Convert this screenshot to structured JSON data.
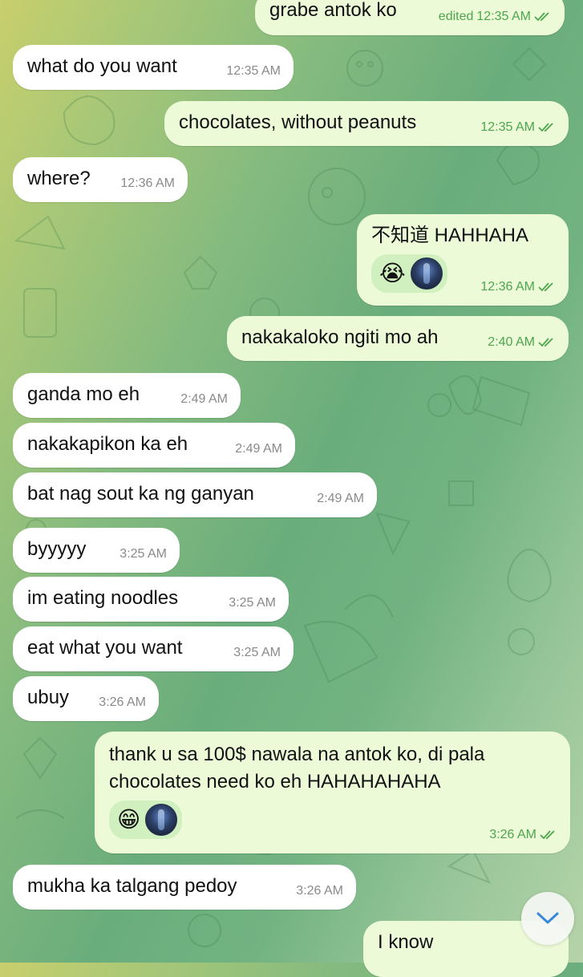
{
  "chat": {
    "messages": [
      {
        "id": "m1",
        "side": "out",
        "text": "grabe antok ko",
        "edited_label": "edited",
        "time": "12:35 AM",
        "read": true
      },
      {
        "id": "m2",
        "side": "in",
        "text": "what do you want",
        "time": "12:35 AM"
      },
      {
        "id": "m3",
        "side": "out",
        "text": "chocolates, without peanuts",
        "time": "12:35 AM",
        "read": true
      },
      {
        "id": "m4",
        "side": "in",
        "text": "where?",
        "time": "12:36 AM"
      },
      {
        "id": "m5",
        "side": "out",
        "text": "不知道 HAHHAHA",
        "reaction_emoji": "😭",
        "reaction_avatar": "avatar",
        "time": "12:36 AM",
        "read": true
      },
      {
        "id": "m6",
        "side": "out",
        "text": "nakakaloko ngiti mo ah",
        "time": "2:40 AM",
        "read": true
      },
      {
        "id": "m7",
        "side": "in",
        "text": "ganda mo eh",
        "time": "2:49 AM"
      },
      {
        "id": "m8",
        "side": "in",
        "text": "nakakapikon ka eh",
        "time": "2:49 AM"
      },
      {
        "id": "m9",
        "side": "in",
        "text": "bat nag sout ka ng ganyan",
        "time": "2:49 AM"
      },
      {
        "id": "m10",
        "side": "in",
        "text": "byyyyy",
        "time": "3:25 AM"
      },
      {
        "id": "m11",
        "side": "in",
        "text": "im eating noodles",
        "time": "3:25 AM"
      },
      {
        "id": "m12",
        "side": "in",
        "text": "eat what you want",
        "time": "3:25 AM"
      },
      {
        "id": "m13",
        "side": "in",
        "text": "ubuy",
        "time": "3:26 AM"
      },
      {
        "id": "m14",
        "side": "out",
        "text": "thank u sa 100$ nawala na antok ko, di pala\nchocolates need ko eh HAHAHAHAHA",
        "reaction_emoji": "😁",
        "reaction_avatar": "avatar",
        "time": "3:26 AM",
        "read": true
      },
      {
        "id": "m15",
        "side": "in",
        "text": "mukha ka talgang pedoy",
        "time": "3:26 AM"
      },
      {
        "id": "m16",
        "side": "out",
        "text": "I know"
      }
    ]
  },
  "scroll_down_button": {
    "icon": "chevron-down-icon"
  },
  "colors": {
    "incoming_bubble": "#ffffff",
    "outgoing_bubble": "#ecfad8",
    "outgoing_meta": "#4da64d",
    "incoming_meta": "#8a8a8a",
    "scroll_chevron": "#3a86d9"
  }
}
